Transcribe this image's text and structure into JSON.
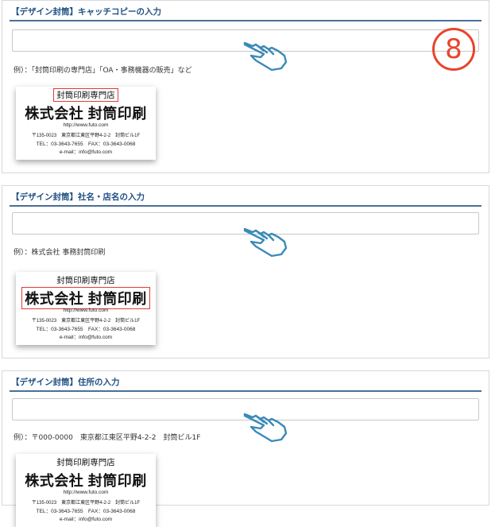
{
  "step_badge": "8",
  "sections": [
    {
      "title": "【デザイン封筒】キャッチコピーの入力",
      "input_value": "",
      "example": "例）：「封筒印刷の専門店」「OA・事務機器の販売」など"
    },
    {
      "title": "【デザイン封筒】社名・店名の入力",
      "input_value": "",
      "example": "例）：株式会社 事務封筒印刷"
    },
    {
      "title": "【デザイン封筒】住所の入力",
      "input_value": "",
      "example": "例）：〒000-0000　東京都江東区平野4-2-2　封筒ビル1F"
    }
  ],
  "card": {
    "catch": "封筒印刷専門店",
    "company": "株式会社 封筒印刷",
    "url": "http://www.futo.com",
    "address": "〒135-0023　東京都江東区平野4-2-2　封筒ビル1F",
    "tel": "TEL：03-3643-7655　FAX：03-3643-0068",
    "email": "e-mail：info@futo.com"
  },
  "colors": {
    "title": "#1f4f82",
    "header_rule": "#4a6f94",
    "highlight": "#e03a3a",
    "badge": "#e8442c",
    "hand_stroke": "#3a8ab8"
  },
  "icons": [
    "pointing-hand-icon"
  ]
}
